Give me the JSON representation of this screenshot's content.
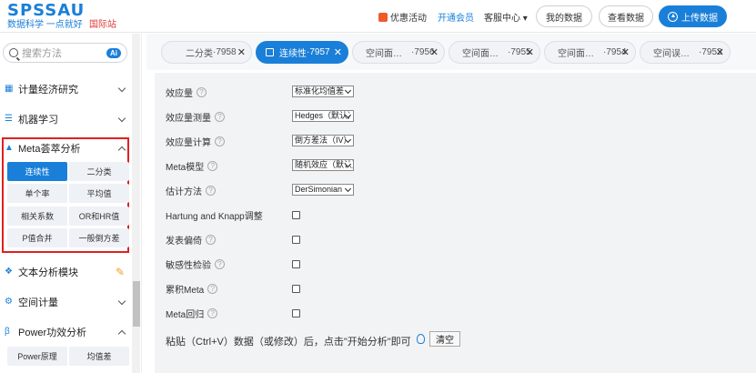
{
  "header": {
    "logo": "SPSSAU",
    "slogan": "数据科学 一点就好",
    "intl": "国际站",
    "promo": "优惠活动",
    "vip": "开通会员",
    "service": "客服中心",
    "my_data": "我的数据",
    "view_data": "查看数据",
    "upload": "上传数据"
  },
  "sidebar": {
    "search_placeholder": "搜索方法",
    "ai_badge": "Ai",
    "items": [
      {
        "label": "计量经济研究",
        "icon": "grid-icon"
      },
      {
        "label": "机器学习",
        "icon": "list-icon"
      },
      {
        "label": "Meta荟萃分析",
        "icon": "triangle-icon"
      },
      {
        "label": "文本分析模块",
        "icon": "diamond-icon"
      },
      {
        "label": "空间计量",
        "icon": "gear-icon"
      },
      {
        "label": "Power功效分析",
        "icon": "beta-icon"
      }
    ],
    "meta_sub": [
      "连续性",
      "二分类",
      "单个率",
      "平均值",
      "相关系数",
      "OR和HR值",
      "P值合并",
      "一般倒方差"
    ],
    "power_sub": [
      "Power原理",
      "均值差"
    ]
  },
  "tabs": [
    {
      "label": "二分类",
      "num": "·7958"
    },
    {
      "label": "连续性",
      "num": "·7957"
    },
    {
      "label": "空间面…",
      "num": "·7956"
    },
    {
      "label": "空间面…",
      "num": "·7955"
    },
    {
      "label": "空间面…",
      "num": "·7954"
    },
    {
      "label": "空间误…",
      "num": "·7953"
    }
  ],
  "form": {
    "effect_size": {
      "label": "效应量",
      "value": "标准化均值差"
    },
    "effect_measure": {
      "label": "效应量测量",
      "value": "Hedges（默认）"
    },
    "effect_calc": {
      "label": "效应量计算",
      "value": "倒方差法（IV）"
    },
    "meta_model": {
      "label": "Meta模型",
      "value": "随机效应（默认）"
    },
    "estimation": {
      "label": "估计方法",
      "value": "DerSimonian"
    },
    "hartung": {
      "label": "Hartung and Knapp调整"
    },
    "pub_bias": {
      "label": "发表偏倚"
    },
    "sensitivity": {
      "label": "敏感性检验"
    },
    "cumulative": {
      "label": "累积Meta"
    },
    "meta_reg": {
      "label": "Meta回归"
    },
    "paste_hint": "粘贴（Ctrl+V）数据（或修改）后，点击\"开始分析\"即可",
    "clear": "清空"
  }
}
